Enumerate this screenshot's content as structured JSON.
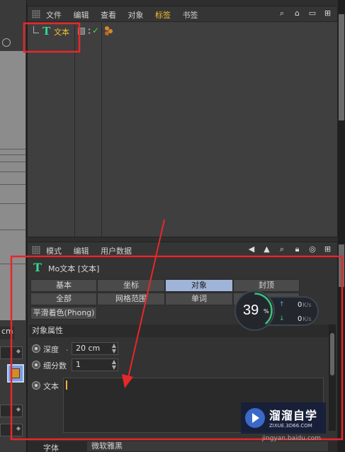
{
  "object_manager": {
    "menu": [
      "文件",
      "编辑",
      "查看",
      "对象",
      "标签",
      "书签"
    ],
    "active_menu": "标签",
    "tool_icons": [
      "search-icon",
      "home-icon",
      "view-icon",
      "new-window-icon"
    ],
    "object": {
      "name": "文本",
      "icon": "text-object-icon",
      "visible_check": "✓"
    }
  },
  "attribute_manager": {
    "menu": [
      "模式",
      "编辑",
      "用户数据"
    ],
    "tool_icons": [
      "back-arrow-icon",
      "up-arrow-icon",
      "search-icon",
      "lock-icon",
      "target-icon",
      "new-window-icon"
    ],
    "title": "Mo文本 [文本]",
    "tabs_row1": [
      "基本",
      "坐标",
      "对象",
      "封顶"
    ],
    "tabs_row2": [
      "全部",
      "网格范围",
      "单词"
    ],
    "tab_phong": "平滑着色(Phong)",
    "active_tab": "对象",
    "section": "对象属性",
    "props": {
      "depth": {
        "label": "深度",
        "value": "20 cm"
      },
      "subdivision": {
        "label": "细分数",
        "value": "1"
      },
      "text": {
        "label": "文本",
        "value": ""
      }
    },
    "font": {
      "label": "字体",
      "value": "微软雅黑"
    }
  },
  "left_panel": {
    "unit": "cm"
  },
  "overlay": {
    "progress": "39",
    "progress_unit": "%",
    "upload": {
      "value": "0",
      "unit": "K/s"
    },
    "download": {
      "value": "0",
      "unit": "K/s"
    }
  },
  "watermark": {
    "title": "溜溜自学",
    "url": "ZIXUE.3D66.COM",
    "small": "jingyan.baidu.com"
  },
  "colors": {
    "highlight": "#f2c12e",
    "active_tab": "#9fb4d8",
    "annotation": "#e8272a",
    "text_icon": "#36d890"
  }
}
